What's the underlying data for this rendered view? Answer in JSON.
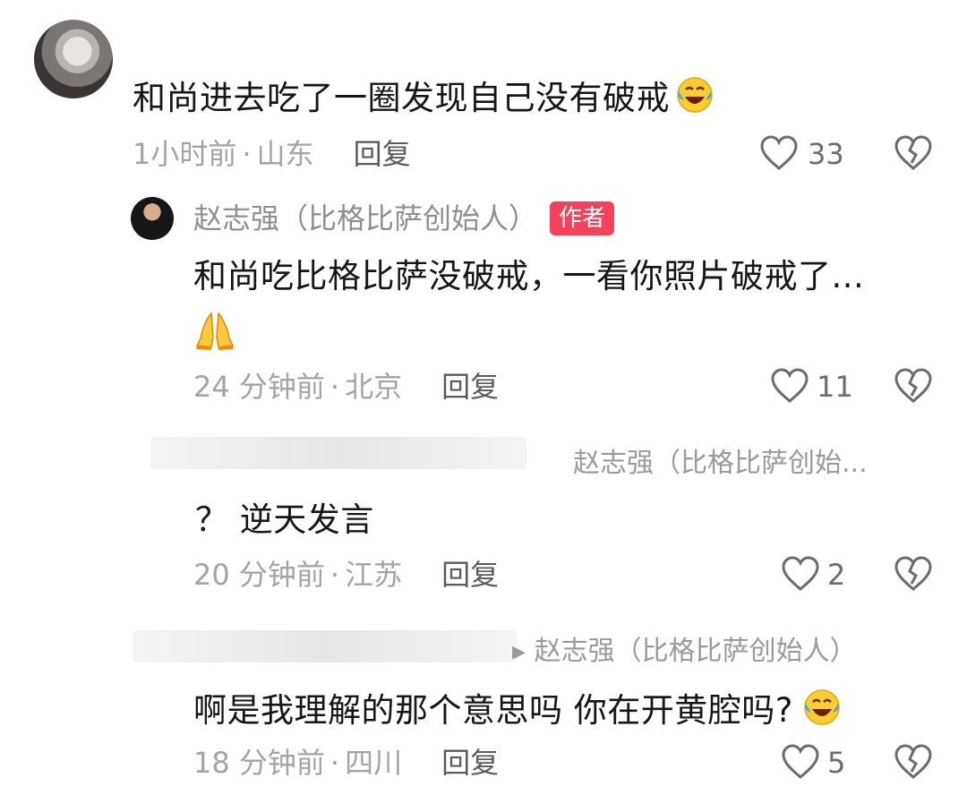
{
  "comments": [
    {
      "text": "和尚进去吃了一圈发现自己没有破戒",
      "time": "1小时前",
      "location": "山东",
      "reply_label": "回复",
      "likes": "33"
    }
  ],
  "author_reply": {
    "name": "赵志强（比格比萨创始人）",
    "badge": "作者",
    "text_line1": "和尚吃比格比萨没破戒，一看你照片破戒了...",
    "time": "24 分钟前",
    "location": "北京",
    "reply_label": "回复",
    "likes": "11"
  },
  "reply_2": {
    "reply_to": "赵志强（比格比萨创始...",
    "text": "？ 逆天发言",
    "time": "20 分钟前",
    "location": "江苏",
    "reply_label": "回复",
    "likes": "2"
  },
  "reply_3": {
    "reply_to": "▸ 赵志强（比格比萨创始人）",
    "text": "啊是我理解的那个意思吗 你在开黄腔吗?",
    "time": "18 分钟前",
    "location": "四川",
    "reply_label": "回复",
    "likes": "5"
  },
  "meta_separator": "·",
  "icons": {
    "like": "heart-outline-icon",
    "dislike": "broken-heart-icon",
    "laugh_emoji": "crying-laughing-emoji",
    "pray_emoji": "folded-hands-emoji"
  },
  "colors": {
    "badge": "#f2425c",
    "meta": "#a4a4a4",
    "text": "#161616"
  }
}
